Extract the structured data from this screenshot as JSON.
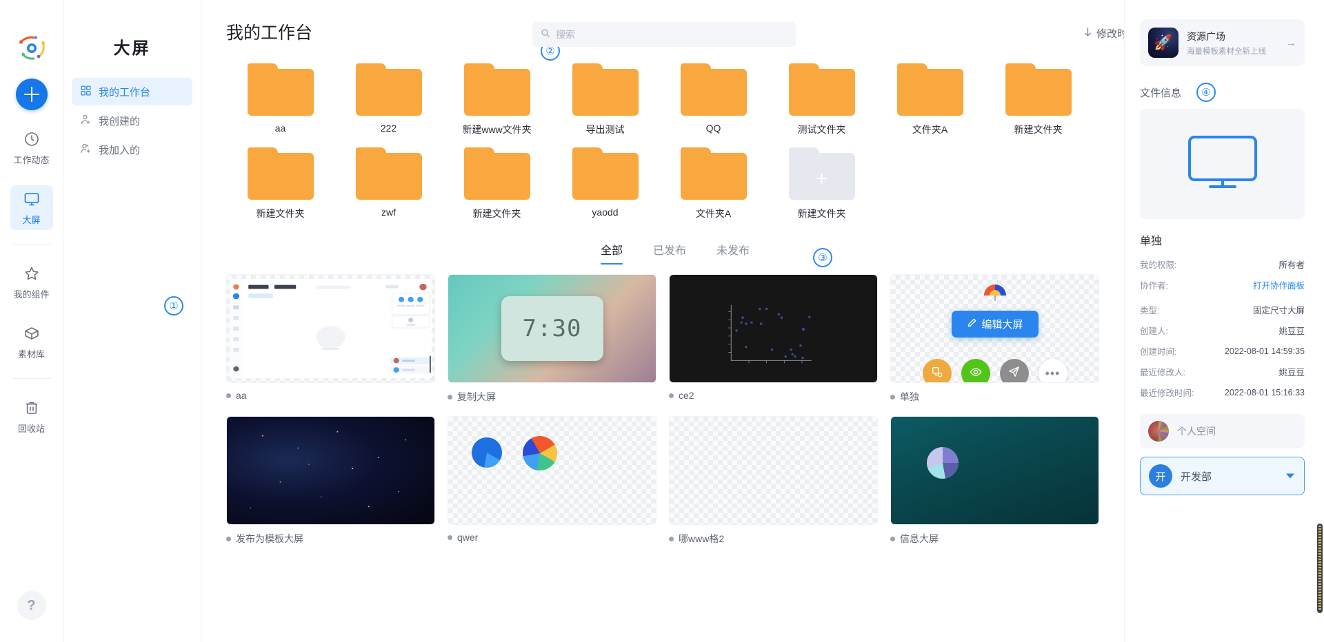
{
  "rail": {
    "logo_name": "brand-logo",
    "add_label": "+",
    "items": [
      {
        "label": "工作动态",
        "icon": "clock-icon",
        "active": false
      },
      {
        "label": "大屏",
        "icon": "monitor-icon",
        "active": true
      },
      {
        "label": "我的组件",
        "icon": "star-icon",
        "active": false
      },
      {
        "label": "素材库",
        "icon": "box-icon",
        "active": false
      },
      {
        "label": "回收站",
        "icon": "trash-icon",
        "active": false
      }
    ],
    "help_label": "?"
  },
  "subnav": {
    "title": "大屏",
    "items": [
      {
        "label": "我的工作台",
        "icon": "grid-icon",
        "active": true
      },
      {
        "label": "我创建的",
        "icon": "user-plus-icon",
        "active": false
      },
      {
        "label": "我加入的",
        "icon": "users-plus-icon",
        "active": false
      }
    ],
    "marker": "①"
  },
  "header": {
    "title": "我的工作台",
    "marker": "②",
    "search_placeholder": "搜索",
    "search_value": "",
    "sort_label": "修改时间",
    "sort_direction_icon": "arrow-down-icon",
    "apps_icon": "apps-grid-icon",
    "avatar_name": "user-avatar"
  },
  "folders": [
    {
      "name": "aa",
      "type": "folder"
    },
    {
      "name": "222",
      "type": "folder"
    },
    {
      "name": "新建www文件夹",
      "type": "folder"
    },
    {
      "name": "导出测试",
      "type": "folder"
    },
    {
      "name": "QQ",
      "type": "folder"
    },
    {
      "name": "测试文件夹",
      "type": "folder"
    },
    {
      "name": "文件夹A",
      "type": "folder"
    },
    {
      "name": "新建文件夹",
      "type": "folder"
    },
    {
      "name": "新建文件夹",
      "type": "folder"
    },
    {
      "name": "zwf",
      "type": "folder"
    },
    {
      "name": "新建文件夹",
      "type": "folder"
    },
    {
      "name": "yaodd",
      "type": "folder"
    },
    {
      "name": "文件夹A",
      "type": "folder"
    },
    {
      "name": "新建文件夹",
      "type": "add"
    }
  ],
  "tabs": {
    "marker": "③",
    "items": [
      {
        "label": "全部",
        "active": true
      },
      {
        "label": "已发布",
        "active": false
      },
      {
        "label": "未发布",
        "active": false
      }
    ]
  },
  "cards": [
    {
      "name": "aa",
      "thumb": "app-screenshot",
      "hovered": false
    },
    {
      "name": "复制大屏",
      "thumb": "clock-photo",
      "clock_digits": "7:30",
      "hovered": false
    },
    {
      "name": "ce2",
      "thumb": "dark-scatter",
      "hovered": false
    },
    {
      "name": "单独",
      "thumb": "transparent",
      "hovered": true
    },
    {
      "name": "发布为模板大屏",
      "thumb": "galaxy",
      "hovered": false
    },
    {
      "name": "qwer",
      "thumb": "two-pies",
      "hovered": false
    },
    {
      "name": "哪www格2",
      "thumb": "transparent",
      "hovered": false
    },
    {
      "name": "信息大屏",
      "thumb": "teal-pie",
      "hovered": false
    }
  ],
  "card_overlay": {
    "edit_label": "编辑大屏",
    "edit_icon": "pencil-icon",
    "actions": [
      {
        "name": "copy-action",
        "icon": "copy-icon",
        "color": "#f0a93c"
      },
      {
        "name": "preview-action",
        "icon": "eye-icon",
        "color": "#52c41a"
      },
      {
        "name": "share-action",
        "icon": "send-icon",
        "color": "#8d8d8d"
      },
      {
        "name": "more-action",
        "icon": "ellipsis-icon",
        "color": "#ffffff"
      }
    ]
  },
  "right": {
    "promo": {
      "title": "资源广场",
      "subtitle": "海量模板素材全新上线",
      "icon": "rocket-icon",
      "arrow": "→"
    },
    "section_title": "文件信息",
    "marker": "④",
    "preview_icon": "monitor-icon",
    "file_name": "单独",
    "info": [
      {
        "key": "我的权限:",
        "value": "所有者",
        "link": false
      },
      {
        "key": "协作者:",
        "value": "打开协作面板",
        "link": true
      },
      {
        "key": "类型:",
        "value": "固定尺寸大屏",
        "link": false
      },
      {
        "key": "创建人:",
        "value": "姚豆豆",
        "link": false
      },
      {
        "key": "创建时间:",
        "value": "2022-08-01 14:59:35",
        "link": false
      },
      {
        "key": "最近修改人:",
        "value": "姚豆豆",
        "link": false
      },
      {
        "key": "最近修改时间:",
        "value": "2022-08-01 15:16:33",
        "link": false
      }
    ],
    "personal_space": "个人空间",
    "department": {
      "badge": "开",
      "label": "开发部"
    }
  },
  "colors": {
    "accent": "#2a86ec",
    "folder": "#f8a83e",
    "folder_add": "#e5e8ee",
    "active_bg": "#e8f2fe",
    "marker": "#2a8bf2"
  }
}
